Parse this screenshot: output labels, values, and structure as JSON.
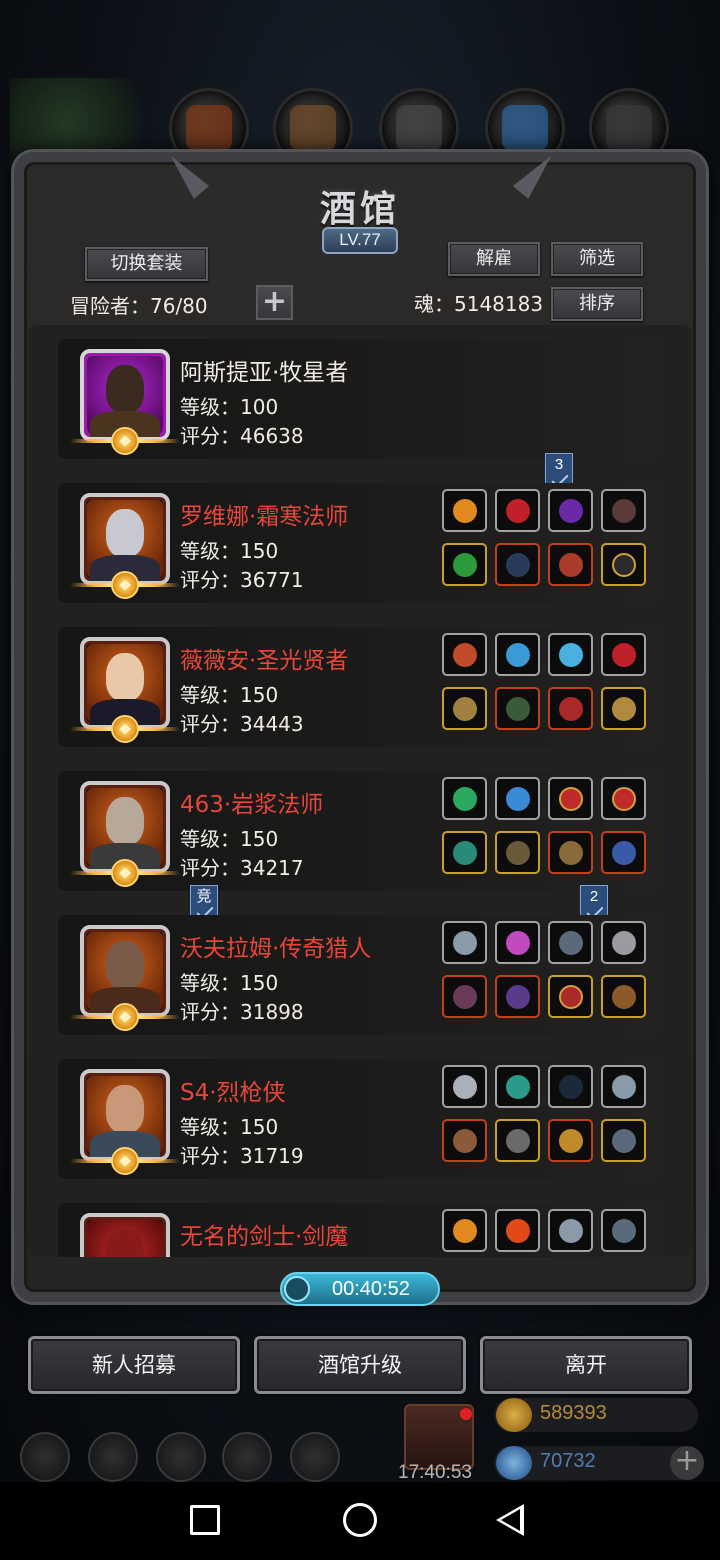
{
  "header": {
    "title": "酒馆",
    "level": "LV.77",
    "switch_outfit": "切换套装",
    "dismiss": "解雇",
    "filter": "筛选",
    "sort": "排序",
    "adventurers": "冒险者：76/80",
    "soul": "魂：5148183",
    "add": "+"
  },
  "adventurers": [
    {
      "name": "阿斯提亚·牧星者",
      "level": "等级：100",
      "score": "评分：46638",
      "special": true,
      "portrait_color": "#7a1f8a"
    },
    {
      "name": "罗维娜·霜寒法师",
      "level": "等级：150",
      "score": "评分：36771",
      "tag": "3",
      "portrait_color": "#b34a1c"
    },
    {
      "name": "薇薇安·圣光贤者",
      "level": "等级：150",
      "score": "评分：34443",
      "portrait_color": "#b34a1c"
    },
    {
      "name": "463·岩浆法师",
      "level": "等级：150",
      "score": "评分：34217",
      "portrait_color": "#b34a1c"
    },
    {
      "name": "沃夫拉姆·传奇猎人",
      "level": "等级：150",
      "score": "评分：31898",
      "tag_left": "竞",
      "tag": "2",
      "portrait_color": "#b34a1c"
    },
    {
      "name": "S4·烈枪侠",
      "level": "等级：150",
      "score": "评分：31719",
      "portrait_color": "#b34a1c"
    },
    {
      "name": "无名的剑士·剑魔",
      "portrait_color": "#b34a1c"
    }
  ],
  "timer": "00:40:52",
  "buttons": {
    "recruit": "新人招募",
    "upgrade": "酒馆升级",
    "leave": "离开"
  },
  "hud": {
    "clock": "17:40:53",
    "gold": "589393",
    "gems": "70732",
    "add": "+"
  },
  "colors": {
    "name_red": "#e8463a",
    "timer_blue": "#3cb8d6",
    "gold": "#d6a030",
    "gem_blue": "#4a8fd6"
  }
}
